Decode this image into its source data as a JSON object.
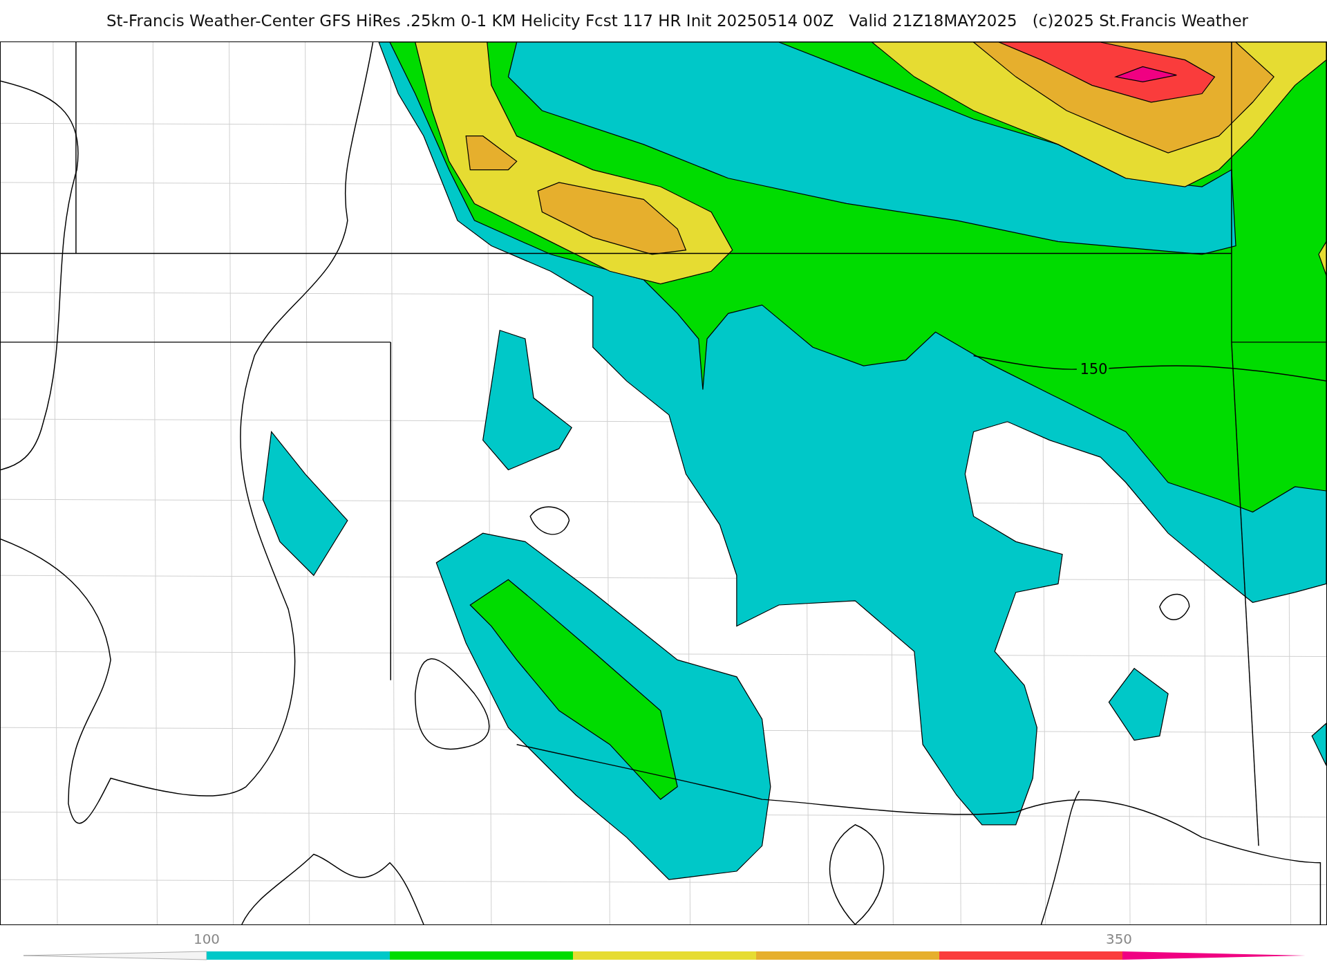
{
  "title": [
    "St-Francis Weather-Center GFS HiRes .25km 0-1 KM Helicity Fcst 117 HR Init 20250514 00Z",
    "Valid 21Z18MAY2025",
    "(c)2025 St.Francis Weather"
  ],
  "map": {
    "contour_labels": [
      "150"
    ]
  },
  "colorbar": {
    "tick_labels": [
      "100",
      "350"
    ],
    "bins": [
      {
        "kind": "low_end",
        "color": "#f4f4f4"
      },
      {
        "kind": "bin",
        "color": "#00c8c8"
      },
      {
        "kind": "bin",
        "color": "#00dc00"
      },
      {
        "kind": "bin",
        "color": "#e6dc32"
      },
      {
        "kind": "bin",
        "color": "#e6af2d"
      },
      {
        "kind": "bin",
        "color": "#fa3c3c"
      },
      {
        "kind": "high_end",
        "color": "#f00082"
      }
    ]
  }
}
